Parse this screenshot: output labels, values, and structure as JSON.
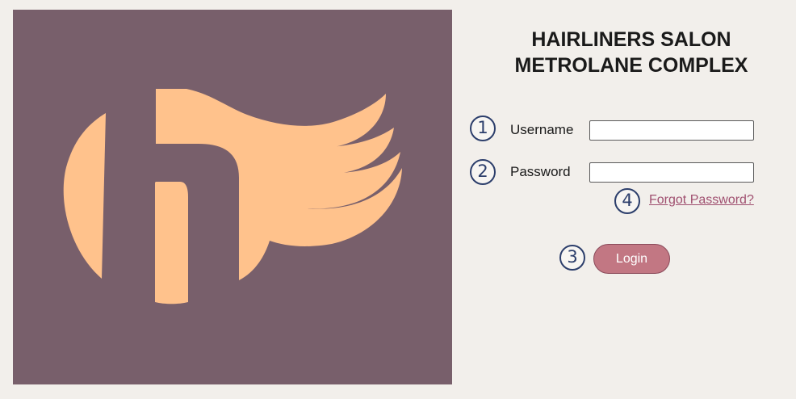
{
  "salon": {
    "title_line1": "HAIRLINERS SALON",
    "title_line2": "METROLANE COMPLEX"
  },
  "logo": {
    "background_color": "#785f6b",
    "mark_color": "#ffc28c",
    "icon": "hairliners-h-logo"
  },
  "form": {
    "username_label": "Username",
    "username_value": "",
    "password_label": "Password",
    "password_value": "",
    "forgot_password_label": "Forgot Password?",
    "login_label": "Login"
  },
  "markers": {
    "username": "1",
    "password": "2",
    "login": "3",
    "forgot_password": "4"
  },
  "colors": {
    "page_background": "#f2efeb",
    "marker_color": "#2c3e6b",
    "link_color": "#a05070",
    "button_color": "#c27783"
  }
}
